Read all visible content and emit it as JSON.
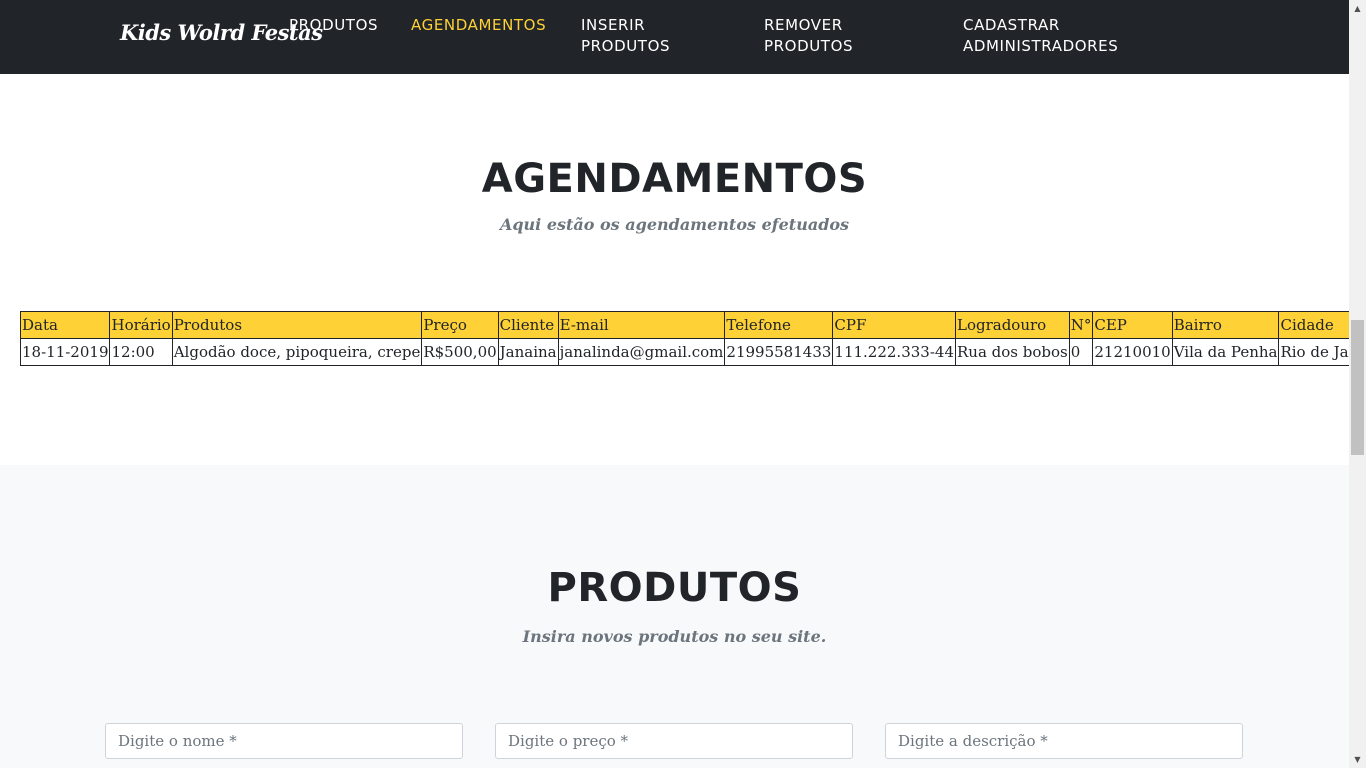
{
  "navbar": {
    "brand": "Kids Wolrd Festas",
    "links": [
      {
        "line1": "PRODUTOS",
        "line2": ""
      },
      {
        "line1": "AGENDAMENTOS",
        "line2": ""
      },
      {
        "line1": "INSERIR",
        "line2": "PRODUTOS"
      },
      {
        "line1": "REMOVER",
        "line2": "PRODUTOS"
      },
      {
        "line1": "CADASTRAR",
        "line2": "ADMINISTRADORES"
      }
    ],
    "active_color": "#fed136"
  },
  "agendamentos": {
    "heading": "AGENDAMENTOS",
    "subheading": "Aqui estão os agendamentos efetuados",
    "columns": [
      "Data",
      "Horário",
      "Produtos",
      "Preço",
      "Cliente",
      "E-mail",
      "Telefone",
      "CPF",
      "Logradouro",
      "N°",
      "CEP",
      "Bairro",
      "Cidade"
    ],
    "rows": [
      [
        "18-11-2019",
        "12:00",
        "Algodão doce, pipoqueira, crepe",
        "R$500,00",
        "Janaina",
        "janalinda@gmail.com",
        "21995581433",
        "111.222.333-44",
        "Rua dos bobos",
        "0",
        "21210010",
        "Vila da Penha",
        "Rio de Janeiro"
      ]
    ]
  },
  "produtos": {
    "heading": "PRODUTOS",
    "subheading": "Insira novos produtos no seu site.",
    "fields": {
      "nome_placeholder": "Digite o nome *",
      "preco_placeholder": "Digite o preço *",
      "descricao_placeholder": "Digite a descrição *"
    }
  },
  "colors": {
    "navbar_bg": "#212529",
    "accent": "#fed136",
    "section_alt_bg": "#f8f9fa"
  }
}
